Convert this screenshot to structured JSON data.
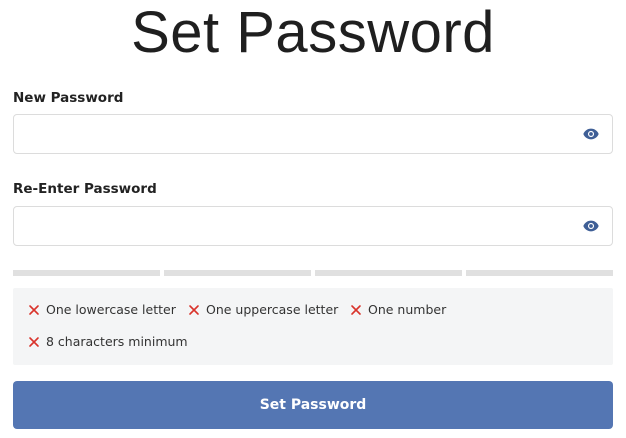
{
  "page": {
    "title": "Set Password"
  },
  "form": {
    "new_password": {
      "label": "New Password",
      "value": "",
      "placeholder": ""
    },
    "reenter_password": {
      "label": "Re-Enter Password",
      "value": "",
      "placeholder": ""
    },
    "toggle_icon": "eye-icon",
    "strength_meter": {
      "segments": 4,
      "filled": 0,
      "empty_color": "#e0e0e0"
    },
    "requirements": [
      {
        "label": "One lowercase letter",
        "met": false,
        "icon": "x-icon"
      },
      {
        "label": "One uppercase letter",
        "met": false,
        "icon": "x-icon"
      },
      {
        "label": "One number",
        "met": false,
        "icon": "x-icon"
      },
      {
        "label": "8 characters minimum",
        "met": false,
        "icon": "x-icon"
      }
    ],
    "submit_label": "Set Password"
  },
  "colors": {
    "accent": "#5476b3",
    "unmet_icon": "#d9332b",
    "eye_icon": "#3f5f96",
    "requirements_bg": "#f4f5f6"
  }
}
